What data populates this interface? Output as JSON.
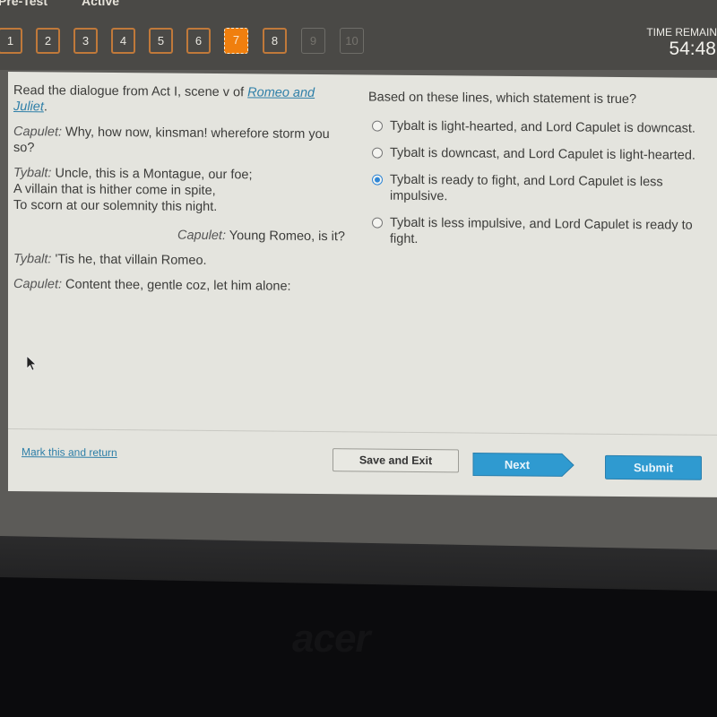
{
  "header": {
    "tabs": [
      "Pre-Test",
      "Active"
    ],
    "question_nav": [
      {
        "label": "1",
        "state": "answered"
      },
      {
        "label": "2",
        "state": "answered"
      },
      {
        "label": "3",
        "state": "answered"
      },
      {
        "label": "4",
        "state": "answered"
      },
      {
        "label": "5",
        "state": "answered"
      },
      {
        "label": "6",
        "state": "answered"
      },
      {
        "label": "7",
        "state": "current"
      },
      {
        "label": "8",
        "state": "answered"
      },
      {
        "label": "9",
        "state": "disabled"
      },
      {
        "label": "10",
        "state": "disabled"
      }
    ],
    "timer_label": "TIME REMAIN",
    "timer_value": "54:48"
  },
  "passage": {
    "intro_prefix": "Read the dialogue from Act I, scene v of ",
    "intro_link": "Romeo and Juliet",
    "intro_suffix": ".",
    "lines": [
      {
        "speaker": "Capulet:",
        "text": " Why, how now, kinsman! wherefore storm you so?"
      },
      {
        "speaker": "Tybalt:",
        "text": " Uncle, this is a Montague, our foe;",
        "continuation": [
          "A villain that is hither come in spite,",
          "To scorn at our solemnity this night."
        ]
      },
      {
        "speaker": "Capulet:",
        "text": " Young Romeo, is it?"
      },
      {
        "speaker": "Tybalt:",
        "text": " 'Tis he, that villain Romeo."
      },
      {
        "speaker": "Capulet:",
        "text": " Content thee, gentle coz, let him alone:"
      }
    ]
  },
  "question": {
    "prompt": "Based on these lines, which statement is true?",
    "options": [
      {
        "text": "Tybalt is light-hearted, and Lord Capulet is downcast.",
        "selected": false
      },
      {
        "text": "Tybalt is downcast, and Lord Capulet is light-hearted.",
        "selected": false
      },
      {
        "text": "Tybalt is ready to fight, and Lord Capulet is less impulsive.",
        "selected": true
      },
      {
        "text": "Tybalt is less impulsive, and Lord Capulet is ready to fight.",
        "selected": false
      }
    ]
  },
  "footer": {
    "mark_link": "Mark this and return",
    "save_label": "Save and Exit",
    "next_label": "Next",
    "submit_label": "Submit"
  },
  "colors": {
    "current_question": "#f07f0e",
    "button_blue": "#2f9ad0",
    "link": "#2e7fa8",
    "radio_selected": "#2f86d6"
  },
  "monitor": {
    "brand": "acer"
  }
}
